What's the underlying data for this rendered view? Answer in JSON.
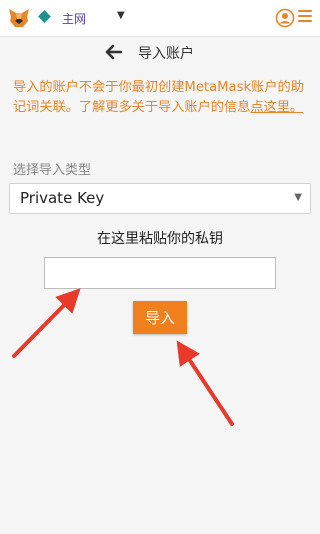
{
  "topbar": {
    "network_name": "主网",
    "network_color": "#1f8f8f",
    "accent": "#e8862a"
  },
  "header": {
    "title": "导入账户"
  },
  "notice": {
    "text": "导入的账户不会于你最初创建MetaMask账户的助记词关联。了解更多关于导入账户的信息",
    "link_text": "点这里。"
  },
  "form": {
    "type_label": "选择导入类型",
    "selected_type": "Private Key",
    "paste_label": "在这里粘贴你的私钥",
    "key_value": "",
    "import_label": "导入"
  }
}
